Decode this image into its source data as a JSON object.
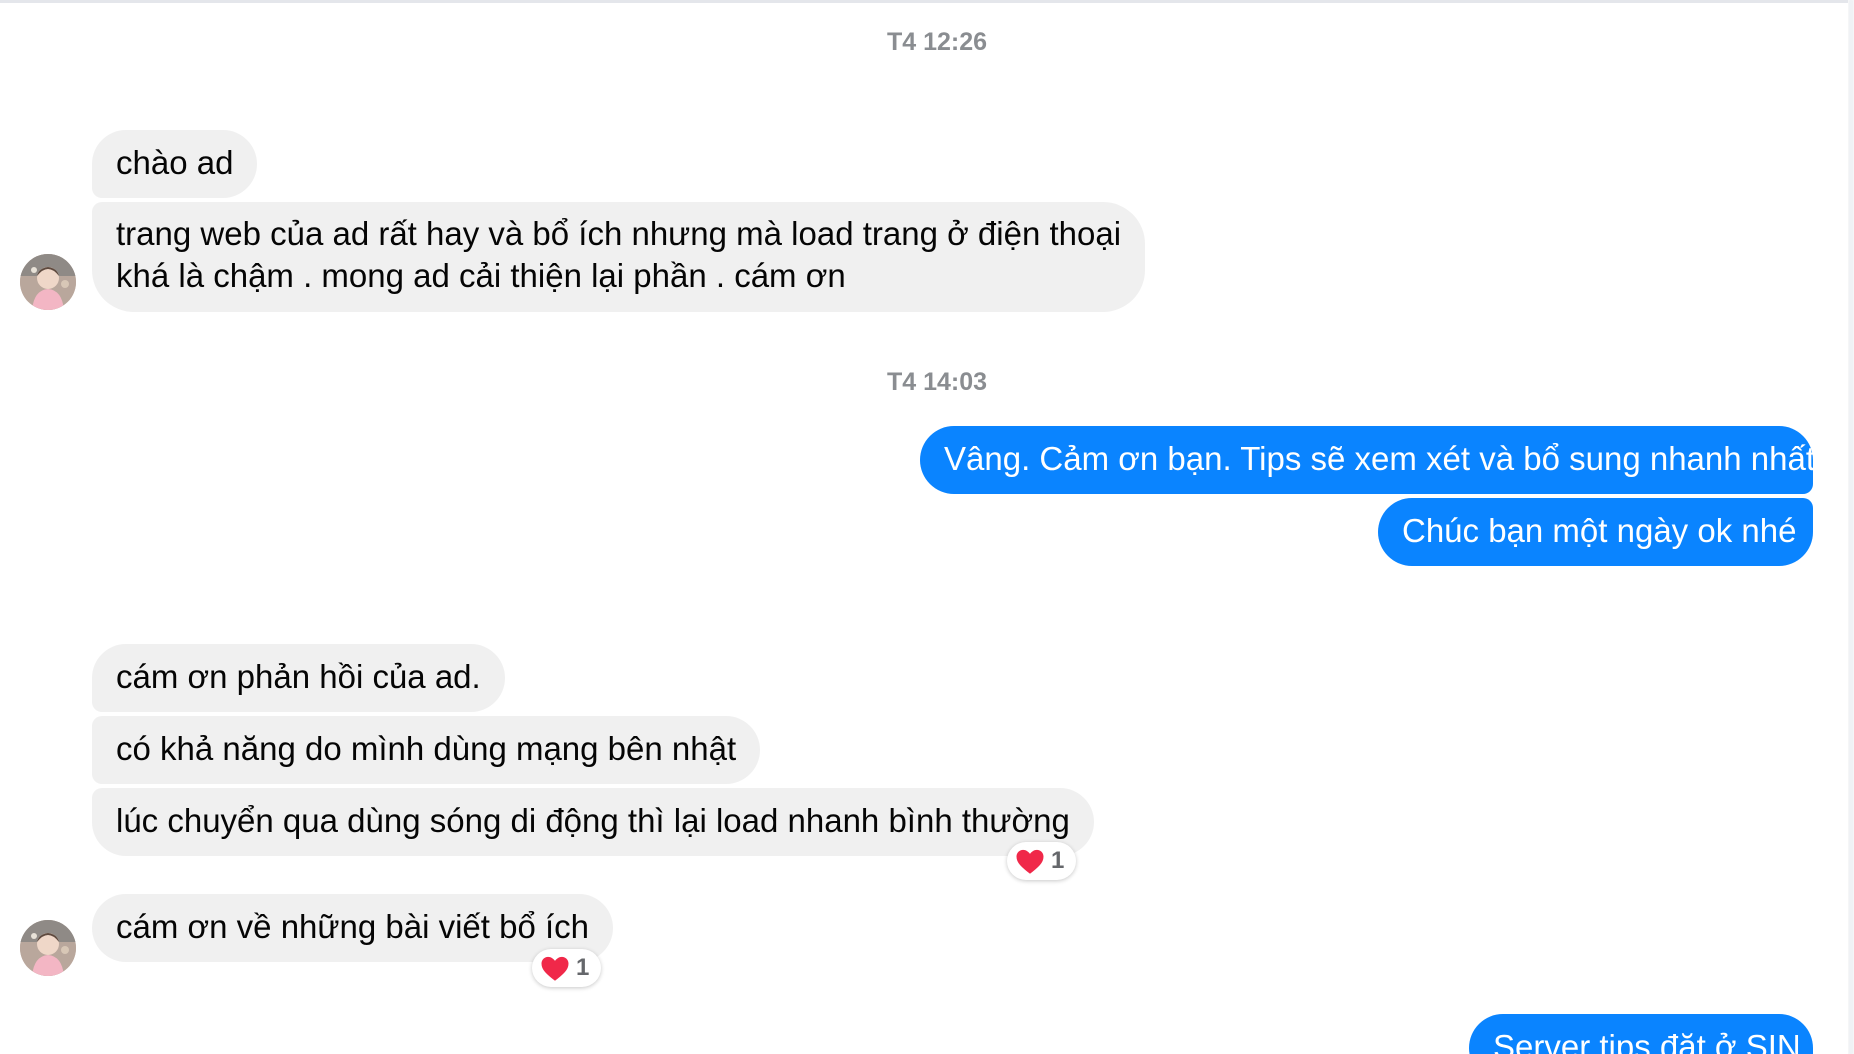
{
  "colors": {
    "incoming_bubble": "#f0f0f0",
    "outgoing_bubble": "#0a84ff",
    "timestamp_text": "#8a8d91",
    "reaction_heart": "#f02849"
  },
  "timestamps": [
    "T4 12:26",
    "T4 14:03"
  ],
  "messages": [
    {
      "direction": "incoming",
      "text": "chào ad"
    },
    {
      "direction": "incoming",
      "lines": [
        "trang web của ad rất hay và bổ ích nhưng mà load trang ở điện thoại",
        "khá là chậm . mong ad cải thiện lại phần . cám ơn"
      ]
    },
    {
      "direction": "outgoing",
      "text": "Vâng. Cảm ơn bạn. Tips sẽ xem xét và bổ sung nhanh nhất"
    },
    {
      "direction": "outgoing",
      "text": "Chúc bạn một ngày ok nhé"
    },
    {
      "direction": "incoming",
      "text": "cám ơn phản hồi của ad."
    },
    {
      "direction": "incoming",
      "text": "có khả năng do mình dùng mạng bên nhật"
    },
    {
      "direction": "incoming",
      "text": "lúc chuyển qua dùng sóng di động thì lại load nhanh bình thường",
      "reaction": {
        "icon": "heart-icon",
        "count": "1"
      }
    },
    {
      "direction": "incoming",
      "text": "cám ơn về những bài viết bổ ích",
      "reaction": {
        "icon": "heart-icon",
        "count": "1"
      }
    },
    {
      "direction": "outgoing",
      "text": "Server tips đặt ở SIN"
    }
  ]
}
